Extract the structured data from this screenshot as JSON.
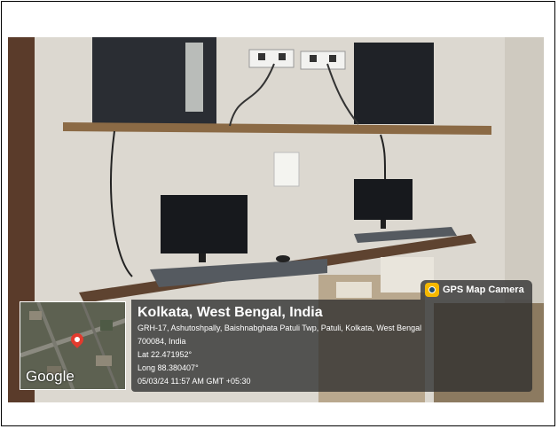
{
  "badge": {
    "label": "GPS Map Camera",
    "icon": "gps-camera-app-icon"
  },
  "location": {
    "title": "Kolkata, West Bengal, India",
    "address_line1": "GRH-17, Ashutoshpally, Baishnabghata Patuli Twp, Patuli, Kolkata, West Bengal",
    "address_line2": "700084, India",
    "lat": "Lat 22.471952°",
    "long": "Long 88.380407°",
    "timestamp": "05/03/24 11:57 AM GMT +05:30"
  },
  "map": {
    "brand": "Google",
    "pin_color": "#e23b2e"
  }
}
